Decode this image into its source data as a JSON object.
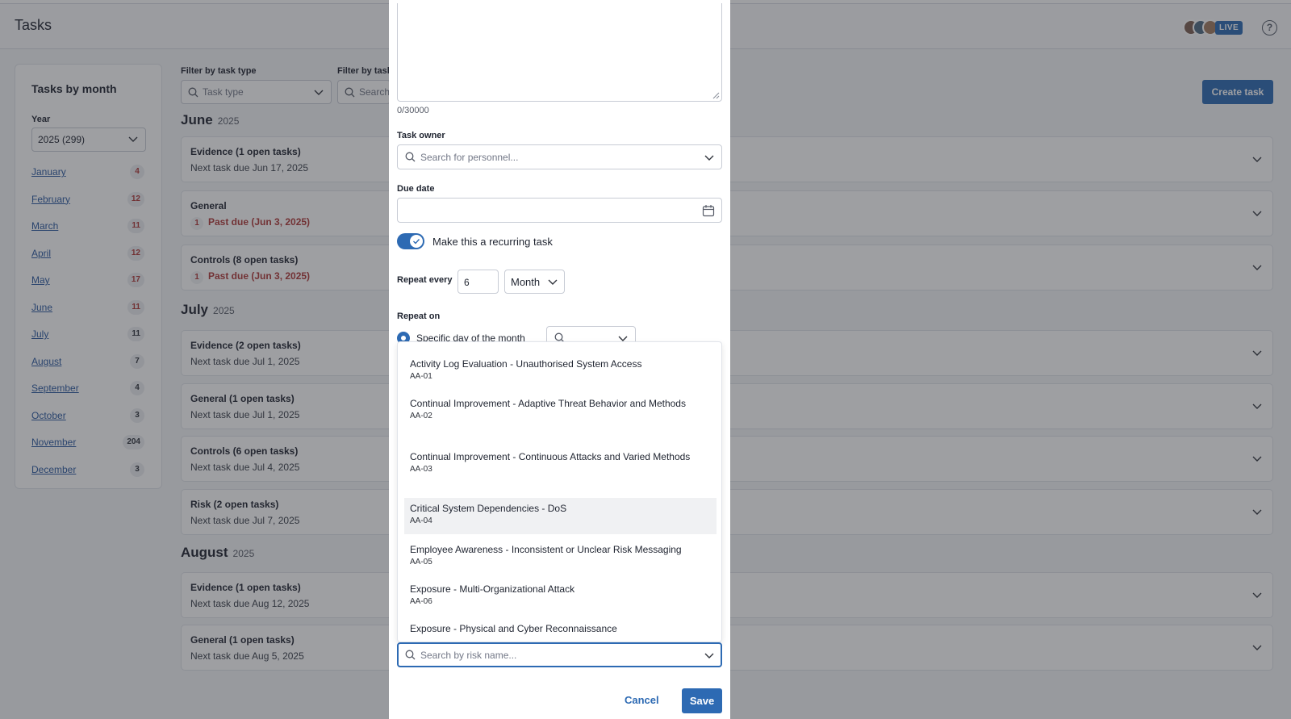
{
  "app": {
    "title": "Tasks",
    "live_badge": "LIVE",
    "help_glyph": "?"
  },
  "sidebar": {
    "title": "Tasks by month",
    "year_label": "Year",
    "year_value": "2025 (299)",
    "months": [
      {
        "name": "January",
        "count": "4"
      },
      {
        "name": "February",
        "count": "12"
      },
      {
        "name": "March",
        "count": "11"
      },
      {
        "name": "April",
        "count": "12"
      },
      {
        "name": "May",
        "count": "17"
      },
      {
        "name": "June",
        "count": "11"
      },
      {
        "name": "July",
        "count": "11"
      },
      {
        "name": "August",
        "count": "7"
      },
      {
        "name": "September",
        "count": "4"
      },
      {
        "name": "October",
        "count": "3"
      },
      {
        "name": "November",
        "count": "204"
      },
      {
        "name": "December",
        "count": "3"
      }
    ]
  },
  "filters": {
    "task_type_label": "Filter by task type",
    "task_type_placeholder": "Task type",
    "second_label": "Filter by task",
    "second_placeholder": "Search"
  },
  "create_button": "Create task",
  "groups": {
    "june": {
      "month": "June",
      "year": "2025"
    },
    "july": {
      "month": "July",
      "year": "2025"
    },
    "august": {
      "month": "August",
      "year": "2025"
    }
  },
  "cards": [
    {
      "title": "Evidence (1 open tasks)",
      "sub": "Next task due Jun 17, 2025"
    },
    {
      "title": "General",
      "num": "1",
      "sub": "Past due (Jun 3, 2025)"
    },
    {
      "title": "Controls (8 open tasks)",
      "num": "1",
      "sub": "Past due (Jun 3, 2025)"
    },
    {
      "title": "Evidence (2 open tasks)",
      "sub": "Next task due Jul 1, 2025"
    },
    {
      "title": "General (1 open tasks)",
      "sub": "Next task due Jul 1, 2025"
    },
    {
      "title": "Controls (6 open tasks)",
      "sub": "Next task due Jul 4, 2025"
    },
    {
      "title": "Risk (2 open tasks)",
      "sub": "Next task due Jul 7, 2025"
    },
    {
      "title": "Evidence (1 open tasks)",
      "sub": "Next task due Aug 12, 2025"
    },
    {
      "title": "General (1 open tasks)",
      "sub": "Next task due Aug 5, 2025"
    }
  ],
  "modal": {
    "char_counter": "0/30000",
    "owner_label": "Task owner",
    "owner_placeholder": "Search for personnel...",
    "due_label": "Due date",
    "recurring_label": "Make this a recurring task",
    "recurring_on": true,
    "repeat_every_label": "Repeat every",
    "repeat_every_value": "6",
    "repeat_unit": "Month",
    "repeat_on_label": "Repeat on",
    "repeat_on_option": "Specific day of the month",
    "risk_placeholder": "Search by risk name...",
    "options": [
      {
        "name": "Activity Log Evaluation - Unauthorised System Access",
        "code": "AA-01"
      },
      {
        "name": "Continual Improvement - Adaptive Threat Behavior and Methods",
        "code": "AA-02"
      },
      {
        "name": "Continual Improvement - Continuous Attacks and Varied Methods",
        "code": "AA-03"
      },
      {
        "name": "Critical System Dependencies - DoS",
        "code": "AA-04"
      },
      {
        "name": "Employee Awareness - Inconsistent or Unclear Risk Messaging",
        "code": "AA-05"
      },
      {
        "name": "Exposure - Multi-Organizational Attack",
        "code": "AA-06"
      },
      {
        "name": "Exposure - Physical and Cyber Reconnaissance",
        "code": ""
      }
    ],
    "cancel": "Cancel",
    "save": "Save"
  },
  "colors": {
    "accent": "#2d6ab3",
    "past_due": "#b03a3a",
    "overlay": "rgba(40,42,48,0.45)"
  }
}
